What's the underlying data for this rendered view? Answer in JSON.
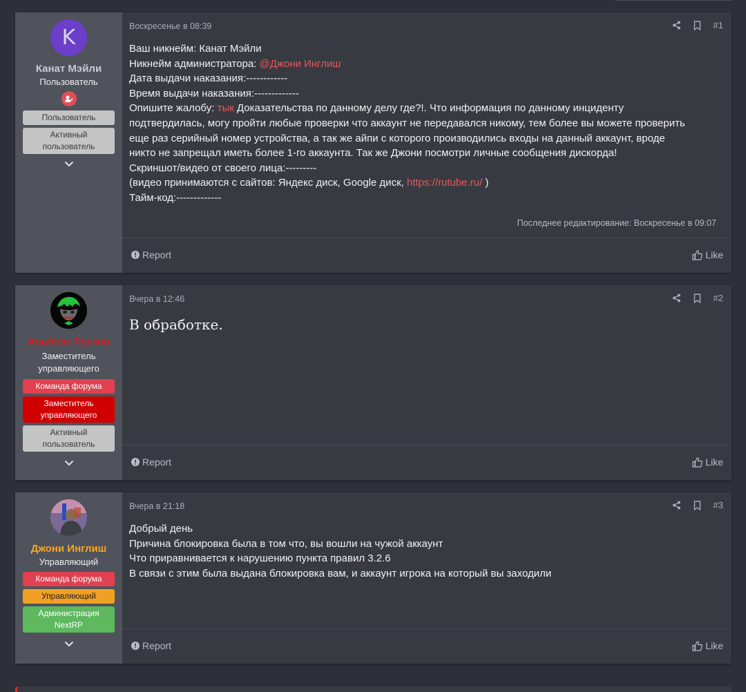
{
  "posts": [
    {
      "user": {
        "avatar_letter": "K",
        "avatar_color": "#6b3fc9",
        "name": "Канат Мэйли",
        "name_color": "#c8cad0",
        "title": "Пользователь",
        "banners": [
          "Пользователь",
          "Активный пользователь"
        ]
      },
      "date": "Воскресенье в 08:39",
      "number": "#1",
      "content": {
        "line1": "Ваш никнейм: Канат Мэйли",
        "line2_prefix": "Никнейм администратора: ",
        "line2_mention": "@Джони Инглиш",
        "line3": "Дата выдачи наказания:------------",
        "line4": "Время выдачи наказания:-------------",
        "line5_prefix": "Опишите жалобу: ",
        "line5_link": "тык",
        "line5_rest": " Доказательства по данному делу где?!. Что информация по данному инциденту",
        "line6": "подтвердилась, могу пройти любые проверки что аккаунт не передавался никому, тем более вы можете проверить",
        "line7": "еще раз серийный номер устройства, а так же айпи с которого производились входы на данный аккаунт, вроде",
        "line8": "никто не запрещал иметь более 1-го аккаунта. Так же Джони посмотри личные сообщения дискорда!",
        "line9": "Скриншот/видео от своего лица:---------",
        "line10_prefix": "(видео принимаются с сайтов: Яндекс диск, Google диск, ",
        "line10_link": "https://rutube.ru/",
        "line10_suffix": " )",
        "line11": "Тайм-код:-------------"
      },
      "edit_note": "Последнее редактирование: Воскресенье в 09:07",
      "report_label": "Report",
      "like_label": "Like"
    },
    {
      "user": {
        "name": "Альберт Русков",
        "name_color": "#d61f1f",
        "title": "Заместитель управляющего",
        "banners": [
          "Команда форума",
          "Заместитель управляющего",
          "Активный пользователь"
        ]
      },
      "date": "Вчера в 12:46",
      "number": "#2",
      "content": {
        "text": "В обработке."
      },
      "report_label": "Report",
      "like_label": "Like"
    },
    {
      "user": {
        "name": "Джони Инглиш",
        "name_color": "#f5a623",
        "title": "Управляющий",
        "banners": [
          "Команда форума",
          "Управляющий",
          "Администрация NextRP"
        ]
      },
      "date": "Вчера в 21:18",
      "number": "#3",
      "content": {
        "line1": "Добрый день",
        "line2": "Причина блокировка была в том что, вы вошли на чужой аккаунт",
        "line3": "Что приравнивается к нарушению пункта правил 3.2.6",
        "line4": "В связи с этим была выдана блокировка вам, и аккаунт игрока на который вы заходили"
      },
      "report_label": "Report",
      "like_label": "Like"
    }
  ],
  "colors": {
    "page_bg": "#2d3038",
    "post_bg": "#383a42",
    "user_panel_bg": "#50535c",
    "accent_link": "#e25a58",
    "muted_text": "#a9adb6"
  },
  "icons": [
    "share-icon",
    "bookmark-icon",
    "chevron-down-icon",
    "info-icon",
    "thumbs-up-icon"
  ]
}
